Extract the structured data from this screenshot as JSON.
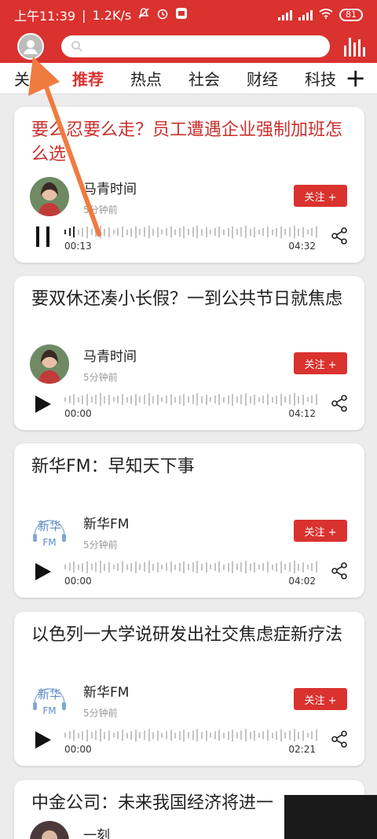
{
  "status": {
    "time": "上午11:39",
    "speed": "1.2K/s",
    "battery": "81"
  },
  "header": {
    "avatar": "user-avatar",
    "search_placeholder": ""
  },
  "tabs": [
    "关注",
    "推荐",
    "热点",
    "社会",
    "财经",
    "科技"
  ],
  "active_tab": 1,
  "follow_label": "关注 +",
  "articles": [
    {
      "title": "要么忍要么走？员工遭遇企业强制加班怎么选",
      "author": "马青时间",
      "time": "5分钟前",
      "cur": "00:13",
      "dur": "04:32",
      "playing": true,
      "progress": 0.048
    },
    {
      "title": "要双休还凑小长假？一到公共节日就焦虑",
      "author": "马青时间",
      "time": "5分钟前",
      "cur": "00:00",
      "dur": "04:12",
      "playing": false,
      "progress": 0
    },
    {
      "title": "新华FM：早知天下事",
      "author": "新华FM",
      "time": "5分钟前",
      "cur": "00:00",
      "dur": "04:02",
      "playing": false,
      "progress": 0
    },
    {
      "title": "以色列一大学说研发出社交焦虑症新疗法",
      "author": "新华FM",
      "time": "5分钟前",
      "cur": "00:00",
      "dur": "02:21",
      "playing": false,
      "progress": 0
    },
    {
      "title": "中金公司：未来我国经济将进一",
      "author": "一刻",
      "time": "",
      "cur": "",
      "dur": "",
      "playing": false,
      "progress": 0
    }
  ],
  "logo_text": "新华FM",
  "colors": {
    "brand": "#d9322f",
    "wave": "#c4c4c4",
    "wave_played": "#2a2a2a"
  }
}
